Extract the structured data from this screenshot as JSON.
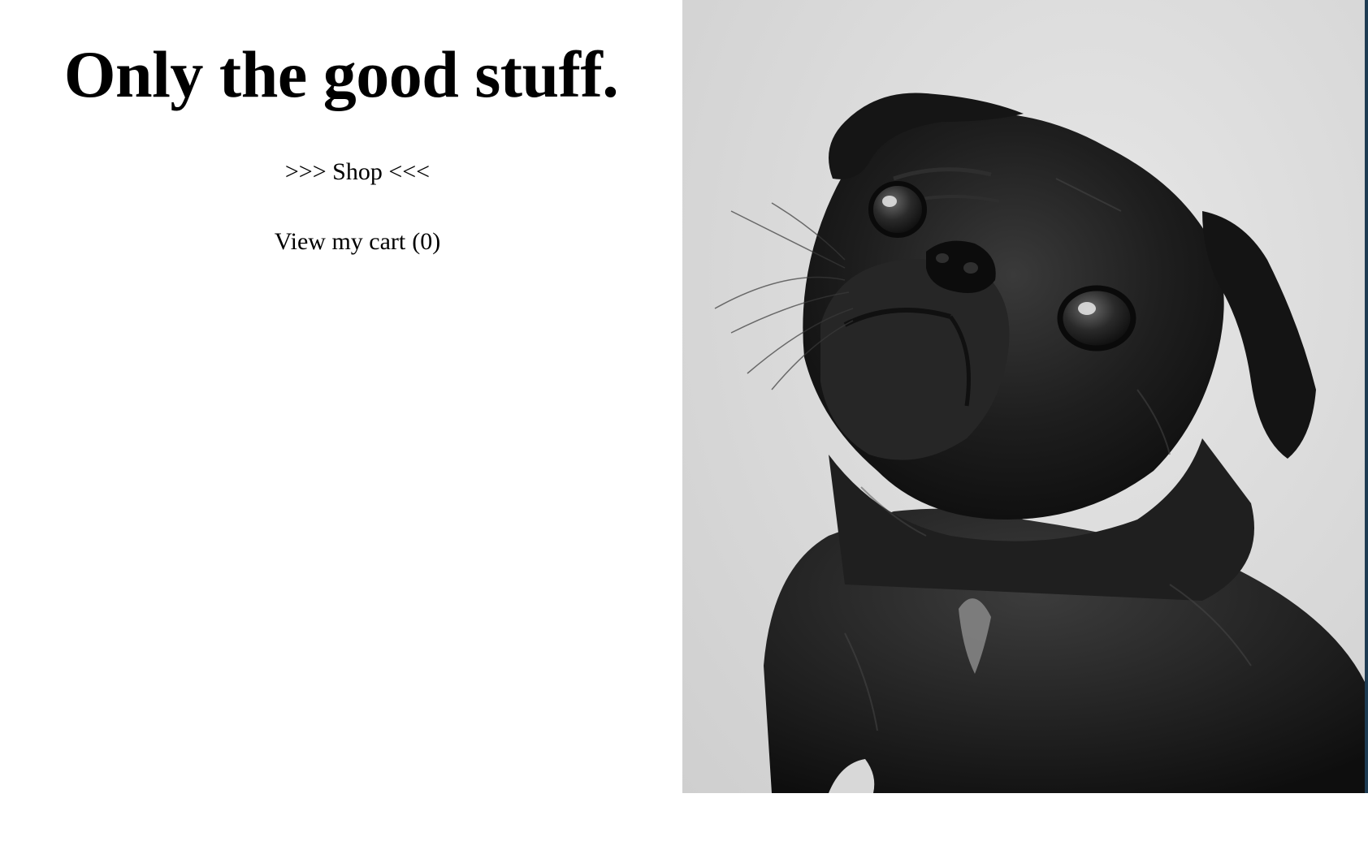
{
  "hero": {
    "headline": "Only the good stuff."
  },
  "nav": {
    "shop_label": ">>> Shop <<<",
    "cart_label": "View my cart",
    "cart_count": "(0)"
  },
  "photo": {
    "subject": "pug",
    "palette": {
      "background": "#dcdcdc",
      "fur": "#1a1a1a",
      "fur_highlight": "#4a4a4a",
      "chest_patch": "#bdbdbd",
      "eye": "#2a2a2a",
      "eye_shine": "#e8e8e8"
    }
  }
}
